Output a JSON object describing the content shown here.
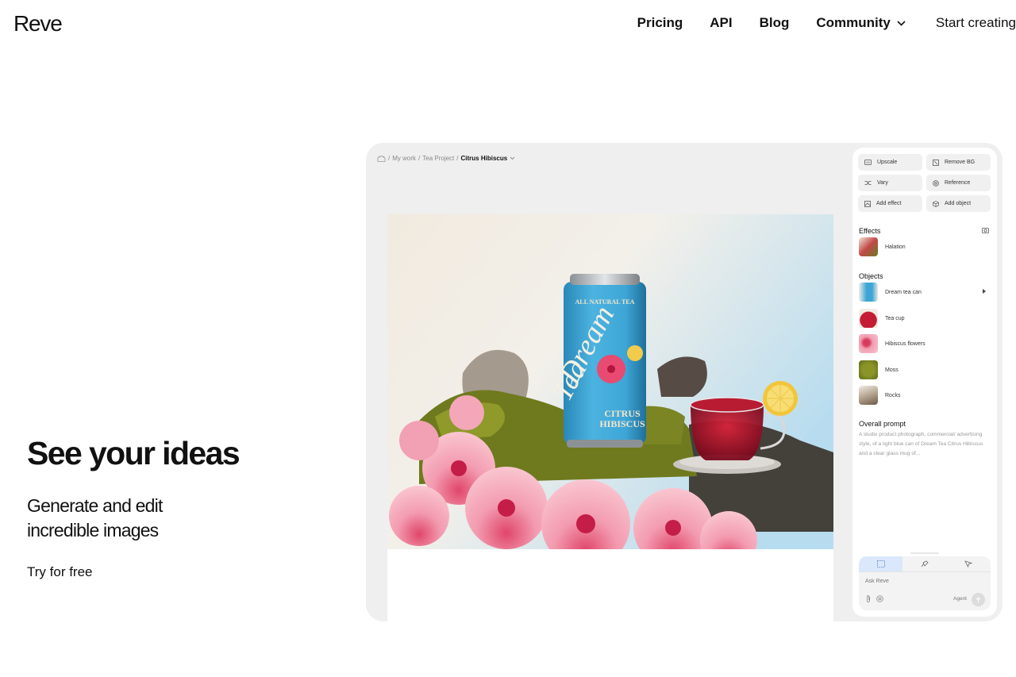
{
  "header": {
    "logo": "Reve",
    "nav": {
      "pricing": "Pricing",
      "api": "API",
      "blog": "Blog",
      "community": "Community",
      "start": "Start creating"
    }
  },
  "hero": {
    "title": "See your ideas",
    "subtitle_line1": "Generate and edit",
    "subtitle_line2": "incredible images",
    "cta": "Try for free"
  },
  "app": {
    "breadcrumb": {
      "home_icon": "home-icon",
      "sep1": "/",
      "my_work": "My work",
      "sep2": "/",
      "project": "Tea Project",
      "sep3": "/",
      "current": "Citrus Hibiscus"
    },
    "image": {
      "can_top": "ALL NATURAL TEA",
      "can_brand_1": "Dream",
      "can_brand_2": "Tea",
      "can_flavor_1": "CITRUS",
      "can_flavor_2": "HIBISCUS"
    },
    "tools": [
      {
        "label": "Upscale",
        "icon": "upscale-icon"
      },
      {
        "label": "Remove BG",
        "icon": "remove-bg-icon"
      },
      {
        "label": "Vary",
        "icon": "shuffle-icon"
      },
      {
        "label": "Reference",
        "icon": "at-icon"
      },
      {
        "label": "Add effect",
        "icon": "effect-icon"
      },
      {
        "label": "Add object",
        "icon": "cube-icon"
      }
    ],
    "effects_label": "Effects",
    "effects": [
      {
        "label": "Halation"
      }
    ],
    "objects_label": "Objects",
    "objects": [
      {
        "label": "Dream tea can"
      },
      {
        "label": "Tea cup"
      },
      {
        "label": "Hibiscus flowers"
      },
      {
        "label": "Moss"
      },
      {
        "label": "Rocks"
      }
    ],
    "prompt_label": "Overall prompt",
    "prompt_text": "A studio product photograph, commercial/ advertising style, of a light blue can of Dream Tea Citrus Hibiscus and a clear glass mug of...",
    "composer": {
      "placeholder": "Ask Reve",
      "agent": "Agent"
    }
  },
  "colors": {
    "accent_tab": "#dbe8fb",
    "app_bg": "#efefef",
    "can_blue": "#3ea6d6"
  }
}
